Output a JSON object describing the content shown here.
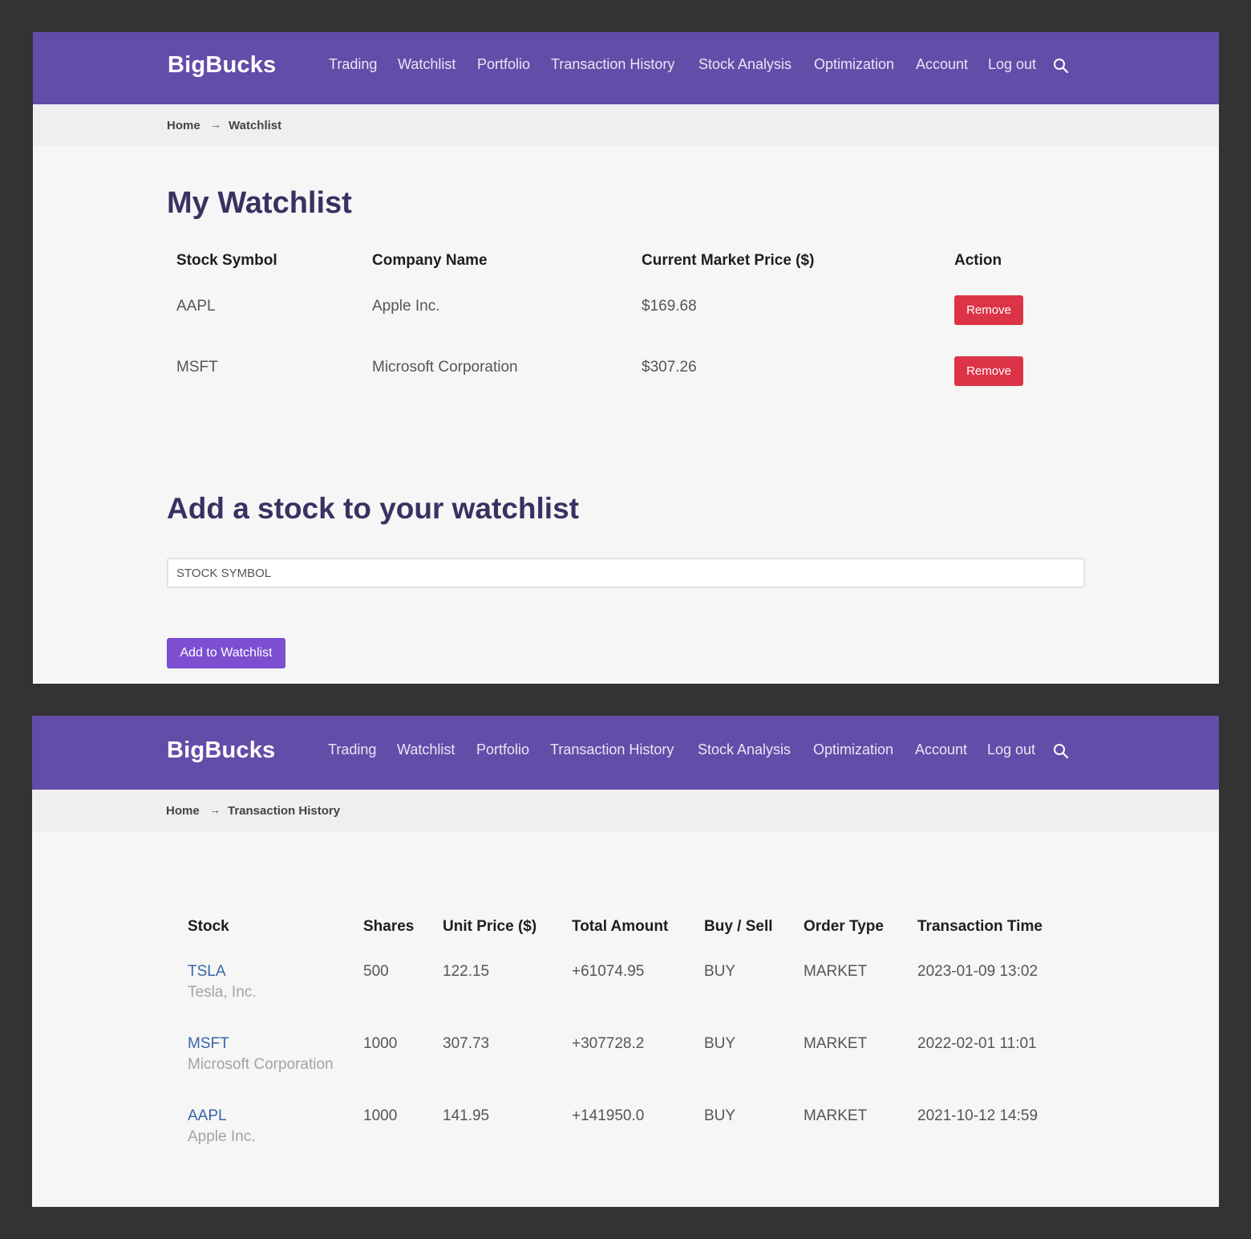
{
  "colors": {
    "nav_bg": "#624ea8",
    "accent_purple": "#7b4fd0",
    "danger_red": "#dc3446",
    "title_dark_purple": "#3a3162",
    "link_blue": "#3566a8",
    "frame_bg": "#333333"
  },
  "nav": {
    "brand": "BigBucks",
    "items": [
      "Trading",
      "Watchlist",
      "Portfolio",
      "Transaction History",
      "Stock Analysis",
      "Optimization",
      "Account",
      "Log out"
    ],
    "search_icon": "search-icon"
  },
  "watchlist_page": {
    "breadcrumb": {
      "home": "Home",
      "current": "Watchlist"
    },
    "title": "My Watchlist",
    "table": {
      "headers": [
        "Stock Symbol",
        "Company Name",
        "Current Market Price ($)",
        "Action"
      ],
      "rows": [
        {
          "symbol": "AAPL",
          "company": "Apple Inc.",
          "price": "$169.68",
          "action": "Remove"
        },
        {
          "symbol": "MSFT",
          "company": "Microsoft Corporation",
          "price": "$307.26",
          "action": "Remove"
        }
      ]
    },
    "add_section": {
      "title": "Add a stock to your watchlist",
      "input_placeholder": "STOCK SYMBOL",
      "input_value": "",
      "button": "Add to Watchlist"
    }
  },
  "history_page": {
    "breadcrumb": {
      "home": "Home",
      "current": "Transaction History"
    },
    "table": {
      "headers": [
        "Stock",
        "Shares",
        "Unit Price ($)",
        "Total Amount",
        "Buy / Sell",
        "Order Type",
        "Transaction Time"
      ],
      "rows": [
        {
          "symbol": "TSLA",
          "company": "Tesla, Inc.",
          "shares": "500",
          "unit_price": "122.15",
          "total": "+61074.95",
          "side": "BUY",
          "order_type": "MARKET",
          "time": "2023-01-09 13:02"
        },
        {
          "symbol": "MSFT",
          "company": "Microsoft Corporation",
          "shares": "1000",
          "unit_price": "307.73",
          "total": "+307728.2",
          "side": "BUY",
          "order_type": "MARKET",
          "time": "2022-02-01 11:01"
        },
        {
          "symbol": "AAPL",
          "company": "Apple Inc.",
          "shares": "1000",
          "unit_price": "141.95",
          "total": "+141950.0",
          "side": "BUY",
          "order_type": "MARKET",
          "time": "2021-10-12 14:59"
        }
      ]
    }
  }
}
